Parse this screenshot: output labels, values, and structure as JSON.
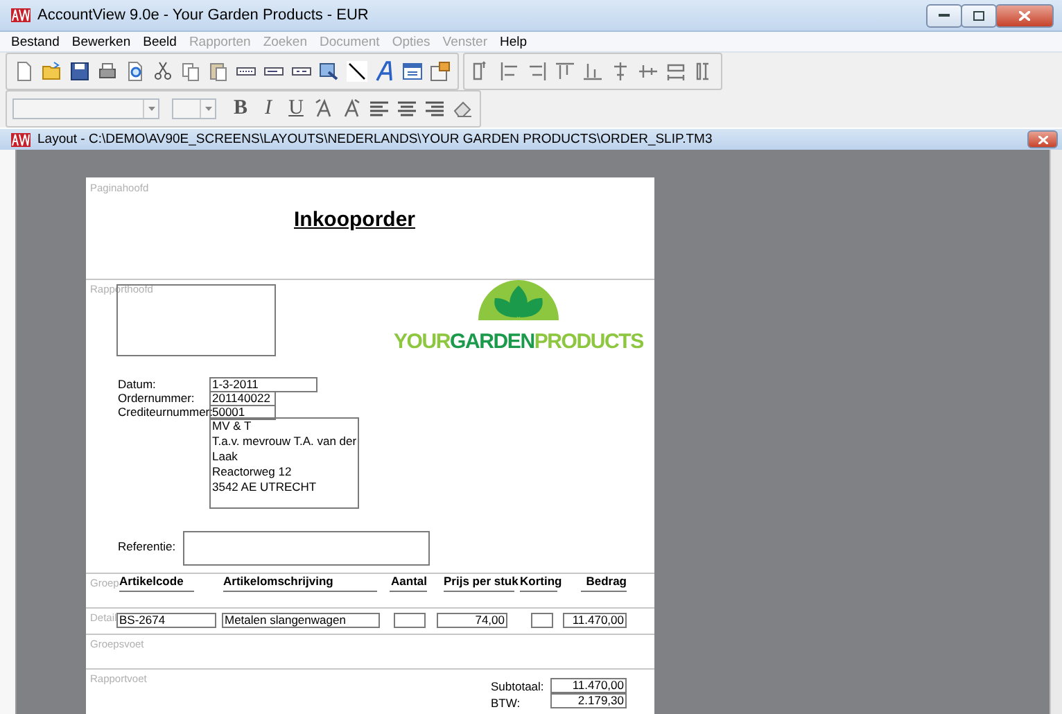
{
  "window": {
    "title": "AccountView 9.0e - Your Garden Products - EUR"
  },
  "menu": [
    {
      "label": "Bestand",
      "disabled": false
    },
    {
      "label": "Bewerken",
      "disabled": false
    },
    {
      "label": "Beeld",
      "disabled": false
    },
    {
      "label": "Rapporten",
      "disabled": true
    },
    {
      "label": "Zoeken",
      "disabled": true
    },
    {
      "label": "Document",
      "disabled": true
    },
    {
      "label": "Opties",
      "disabled": true
    },
    {
      "label": "Venster",
      "disabled": true
    },
    {
      "label": "Help",
      "disabled": false
    }
  ],
  "format_buttons": [
    "B",
    "I",
    "U"
  ],
  "document": {
    "title": "Layout - C:\\DEMO\\AV90E_SCREENS\\LAYOUTS\\NEDERLANDS\\YOUR GARDEN PRODUCTS\\ORDER_SLIP.TM3",
    "sections": [
      {
        "label": "Paginahoofd",
        "kind": "page_header"
      },
      {
        "label": "Rapporthoofd",
        "kind": "report_header"
      },
      {
        "label": "Groep",
        "kind": "group_header"
      },
      {
        "label": "Detail",
        "kind": "detail"
      },
      {
        "label": "Groepsvoet",
        "kind": "group_footer"
      },
      {
        "label": "Rapportvoet",
        "kind": "report_footer"
      }
    ],
    "heading": "Inkooporder",
    "logo": [
      {
        "text": "YOUR",
        "color": "#8dc63f"
      },
      {
        "text": "GARDEN",
        "color": "#1b9a4b"
      },
      {
        "text": "PRODUCTS",
        "color": "#8dc63f"
      }
    ],
    "info_fields": [
      {
        "label": "Datum:",
        "value": "1-3-2011"
      },
      {
        "label": "Ordernummer:",
        "value": "201140022"
      },
      {
        "label": "Crediteurnummer:",
        "value": "50001"
      }
    ],
    "address": [
      "MV & T",
      "T.a.v. mevrouw T.A. van der",
      "Laak",
      "Reactorweg 12",
      "3542 AE UTRECHT"
    ],
    "reference_label": "Referentie:",
    "columns": [
      "Artikelcode",
      "Artikelomschrijving",
      "Aantal",
      "Prijs per stuk",
      "Korting",
      "Bedrag"
    ],
    "detail": [
      {
        "kind": "text",
        "value": "BS-2674"
      },
      {
        "kind": "text",
        "value": "Metalen slangenwagen"
      },
      {
        "kind": "blank"
      },
      {
        "kind": "number",
        "value": "74,00"
      },
      {
        "kind": "blank"
      },
      {
        "kind": "number",
        "value": "11.470,00"
      }
    ],
    "totals": [
      {
        "label": "Subtotaal:",
        "value": "11.470,00"
      },
      {
        "label": "BTW:",
        "value": "2.179,30"
      }
    ]
  }
}
